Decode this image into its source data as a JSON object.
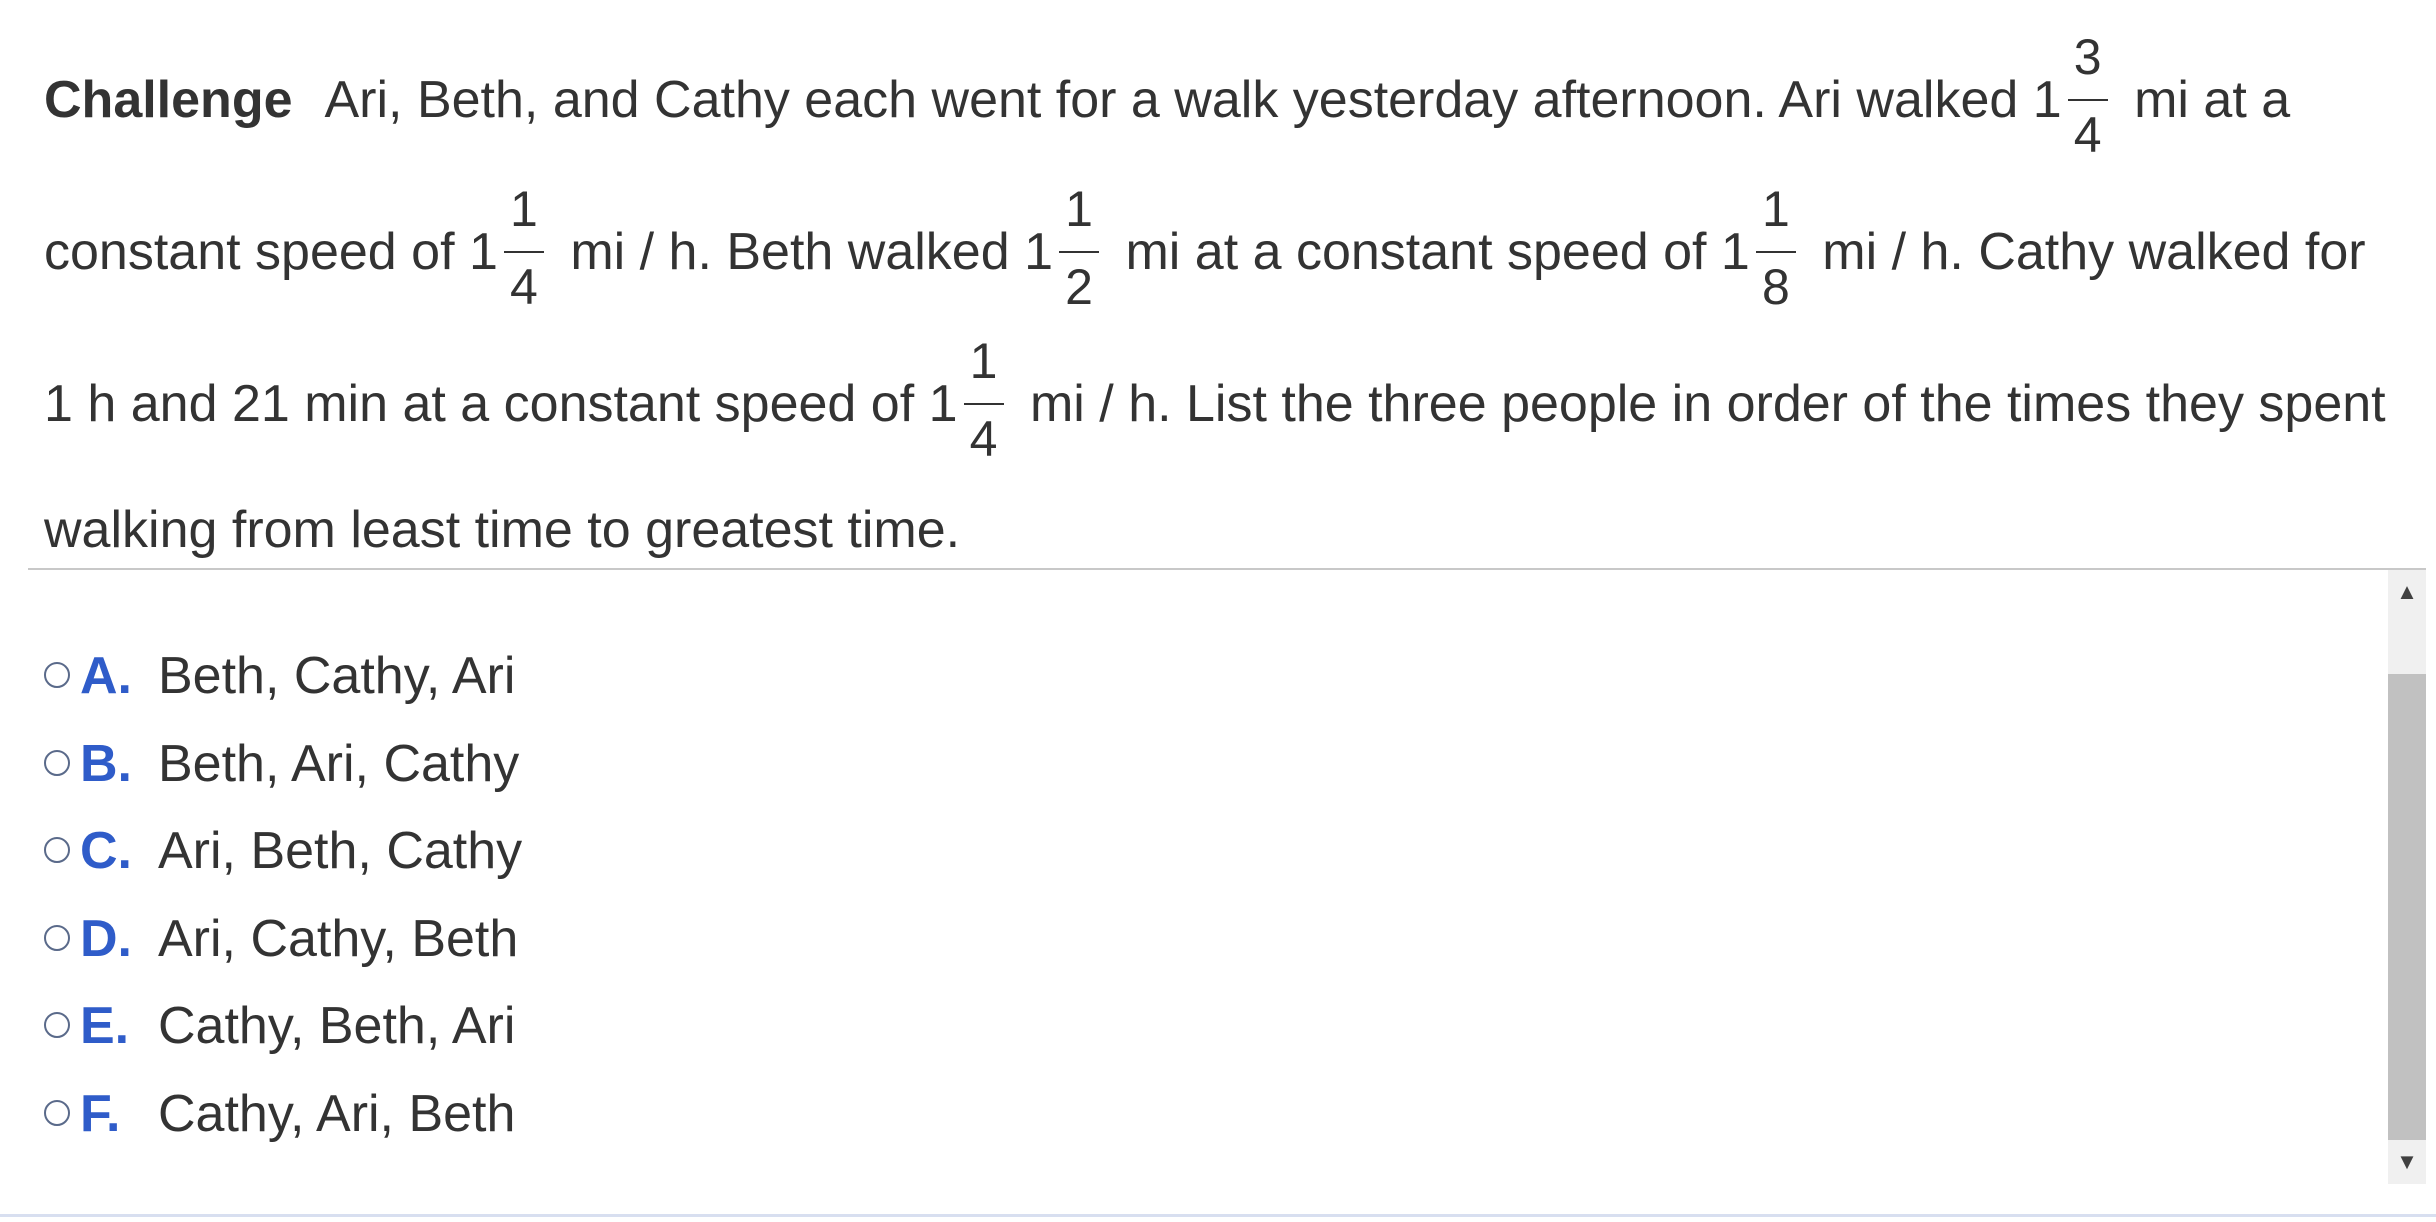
{
  "question": {
    "label": "Challenge",
    "line1": {
      "text_a": "Ari, Beth, and Cathy each went for a walk yesterday afternoon. Ari walked 1",
      "frac": {
        "num": "3",
        "den": "4"
      },
      "text_b": " mi at a"
    },
    "line2": {
      "text_a": "constant speed of 1",
      "frac1": {
        "num": "1",
        "den": "4"
      },
      "text_b": " mi / h. Beth walked 1",
      "frac2": {
        "num": "1",
        "den": "2"
      },
      "text_c": " mi at a constant speed of 1",
      "frac3": {
        "num": "1",
        "den": "8"
      },
      "text_d": " mi / h. Cathy walked for"
    },
    "line3": {
      "text_a": "1 h and 21 min at a constant speed of 1",
      "frac": {
        "num": "1",
        "den": "4"
      },
      "text_b": " mi / h. List the three people in order of the times they spent"
    },
    "line4": "walking from least time to greatest time."
  },
  "options": [
    {
      "letter": "A.",
      "text": "Beth, Cathy, Ari"
    },
    {
      "letter": "B.",
      "text": "Beth, Ari, Cathy"
    },
    {
      "letter": "C.",
      "text": "Ari, Beth, Cathy"
    },
    {
      "letter": "D.",
      "text": "Ari, Cathy, Beth"
    },
    {
      "letter": "E.",
      "text": "Cathy, Beth, Ari"
    },
    {
      "letter": "F.",
      "text": "Cathy, Ari, Beth"
    }
  ],
  "scrollbar": {
    "up_glyph": "▲",
    "down_glyph": "▼"
  },
  "colors": {
    "text": "#333333",
    "option_letter": "#2f5cc9",
    "radio_border": "#5a6a8a",
    "divider": "#c8c8c8",
    "scroll_track": "#f0f0f0",
    "scroll_thumb": "#c1c1c1"
  }
}
